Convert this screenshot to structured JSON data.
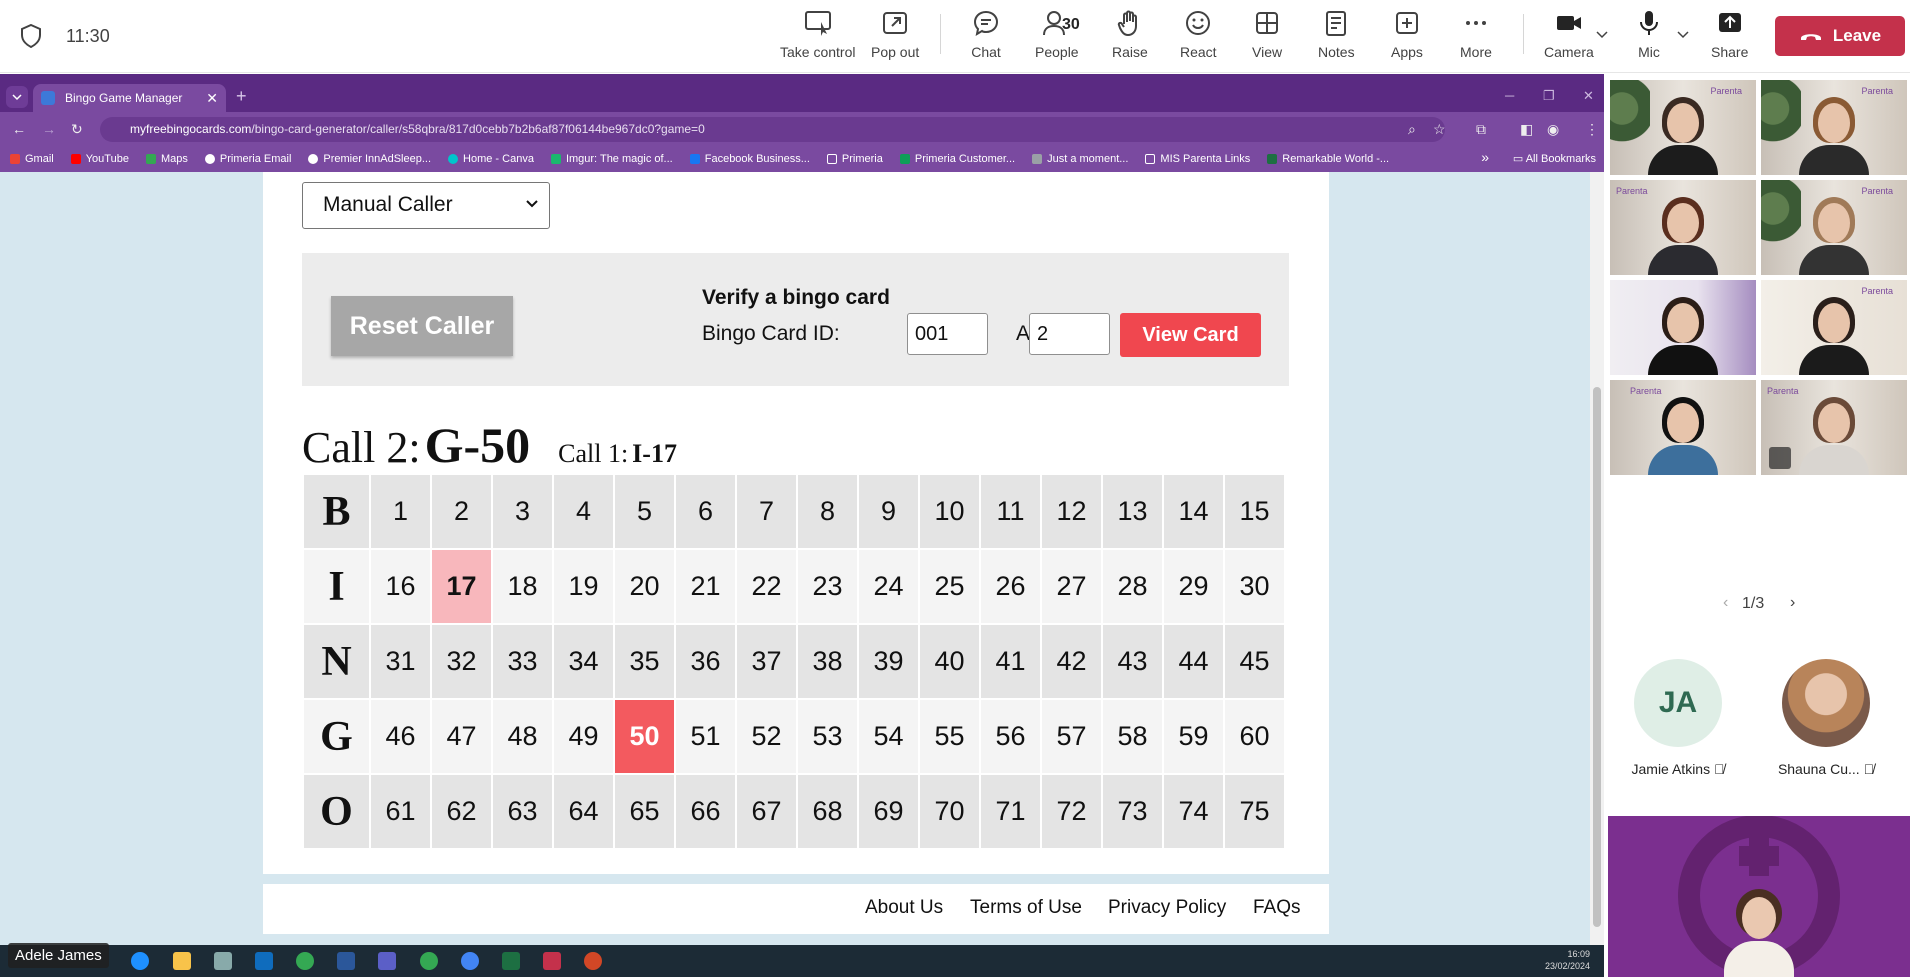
{
  "meeting": {
    "timer": "11:30",
    "toolbar": [
      {
        "id": "take-control",
        "label": "Take control",
        "icon": "take-control-icon"
      },
      {
        "id": "pop-out",
        "label": "Pop out",
        "icon": "pop-out-icon"
      },
      {
        "id": "chat",
        "label": "Chat",
        "icon": "chat-icon"
      },
      {
        "id": "people",
        "label": "People",
        "icon": "people-icon",
        "count": "30"
      },
      {
        "id": "raise",
        "label": "Raise",
        "icon": "raise-hand-icon"
      },
      {
        "id": "react",
        "label": "React",
        "icon": "react-icon"
      },
      {
        "id": "view",
        "label": "View",
        "icon": "view-icon"
      },
      {
        "id": "notes",
        "label": "Notes",
        "icon": "notes-icon"
      },
      {
        "id": "apps",
        "label": "Apps",
        "icon": "apps-icon"
      },
      {
        "id": "more",
        "label": "More",
        "icon": "more-icon"
      },
      {
        "id": "camera",
        "label": "Camera",
        "icon": "camera-icon"
      },
      {
        "id": "mic",
        "label": "Mic",
        "icon": "mic-icon"
      },
      {
        "id": "share",
        "label": "Share",
        "icon": "share-icon"
      }
    ],
    "leave_label": "Leave",
    "presenter_name": "Adele James",
    "colors": {
      "leave": "#c4314b",
      "accent": "#5b5fc7"
    }
  },
  "browser": {
    "tab_title": "Bingo Game Manager",
    "url_host": "myfreebingocards.com",
    "url_path": "/bingo-card-generator/caller/s58qbra/817d0cebb7b2b6af87f06144be967dc0?game=0",
    "bookmarks": [
      "Gmail",
      "YouTube",
      "Maps",
      "Primeria Email",
      "Premier InnAdSleep...",
      "Home - Canva",
      "Imgur: The magic of...",
      "Facebook Business...",
      "Primeria",
      "Primeria Customer...",
      "Just a moment...",
      "MIS Parenta Links",
      "Remarkable World -..."
    ],
    "all_bookmarks": "All Bookmarks",
    "theme": "#7a4aa0"
  },
  "bingo": {
    "mode_select": "Manual Caller",
    "reset_label": "Reset Caller",
    "verify_title": "Verify a bingo card",
    "card_id_label": "Bingo Card ID:",
    "card_id_value": "001",
    "at_call_label": "At Call:",
    "at_call_value": "2",
    "view_card_label": "View Card",
    "current_call_label": "Call 2:",
    "current_call_value": "G-50",
    "previous_call_label": "Call 1:",
    "previous_call_value": "I-17",
    "letters": [
      "B",
      "I",
      "N",
      "G",
      "O"
    ],
    "rows": [
      [
        "1",
        "2",
        "3",
        "4",
        "5",
        "6",
        "7",
        "8",
        "9",
        "10",
        "11",
        "12",
        "13",
        "14",
        "15"
      ],
      [
        "16",
        "17",
        "18",
        "19",
        "20",
        "21",
        "22",
        "23",
        "24",
        "25",
        "26",
        "27",
        "28",
        "29",
        "30"
      ],
      [
        "31",
        "32",
        "33",
        "34",
        "35",
        "36",
        "37",
        "38",
        "39",
        "40",
        "41",
        "42",
        "43",
        "44",
        "45"
      ],
      [
        "46",
        "47",
        "48",
        "49",
        "50",
        "51",
        "52",
        "53",
        "54",
        "55",
        "56",
        "57",
        "58",
        "59",
        "60"
      ],
      [
        "61",
        "62",
        "63",
        "64",
        "65",
        "66",
        "67",
        "68",
        "69",
        "70",
        "71",
        "72",
        "73",
        "74",
        "75"
      ]
    ],
    "called_current": "50",
    "called_previous": "17",
    "footer_links": [
      "About Us",
      "Terms of Use",
      "Privacy Policy",
      "FAQs"
    ],
    "colors": {
      "current": "#f35a5f",
      "previous": "#f8b7bc",
      "view_card": "#f0474f"
    }
  },
  "taskbar": {
    "time": "16:09",
    "date": "23/02/2024"
  },
  "gallery": {
    "page_indicator": "1/3",
    "audio_participants": [
      {
        "initials": "JA",
        "name": "Jamie Atkins"
      },
      {
        "initials": "",
        "name": "Shauna Cu..."
      }
    ],
    "tile_logo": "Parenta"
  }
}
